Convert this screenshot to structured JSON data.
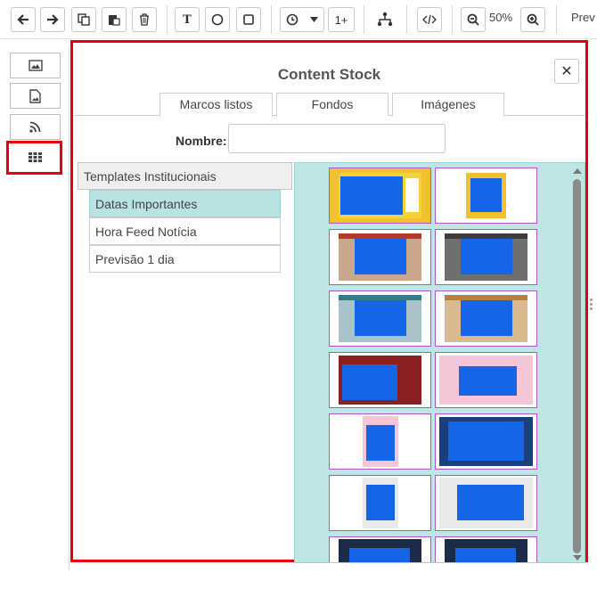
{
  "toolbar": {
    "zoom_value": "50%",
    "counter_label": "1+",
    "text_tool_label": "T",
    "preview_label": "Prev",
    "icons": [
      "arrow-left-icon",
      "arrow-right-icon",
      "copy-icon",
      "paste-icon",
      "trash-icon",
      "text-icon",
      "circle-icon",
      "square-icon",
      "clock-icon",
      "caret-down-icon",
      "counter-icon",
      "hierarchy-icon",
      "code-icon",
      "zoom-out-icon",
      "zoom-in-icon"
    ]
  },
  "sidebar": {
    "items": [
      {
        "name": "image-icon"
      },
      {
        "name": "image-file-icon"
      },
      {
        "name": "rss-icon"
      },
      {
        "name": "grid-icon",
        "active": true
      }
    ]
  },
  "panel": {
    "title": "Content Stock",
    "close_label": "✕",
    "tabs": [
      {
        "label": "Marcos listos",
        "active": true
      },
      {
        "label": "Fondos",
        "active": false
      },
      {
        "label": "Imágenes",
        "active": false
      }
    ],
    "name_label": "Nombre:",
    "name_value": "",
    "category_header": "Templates Institucionais",
    "categories": [
      {
        "label": "Datas Importantes",
        "active": true
      },
      {
        "label": "Hora Feed Notícia",
        "active": false
      },
      {
        "label": "Previsão 1 dia",
        "active": false
      }
    ]
  },
  "colors": {
    "highlight": "#e3000f",
    "selected_bg": "#b8e3e3",
    "content_blue": "#1565e8",
    "thumb_border": "#b055c8"
  }
}
